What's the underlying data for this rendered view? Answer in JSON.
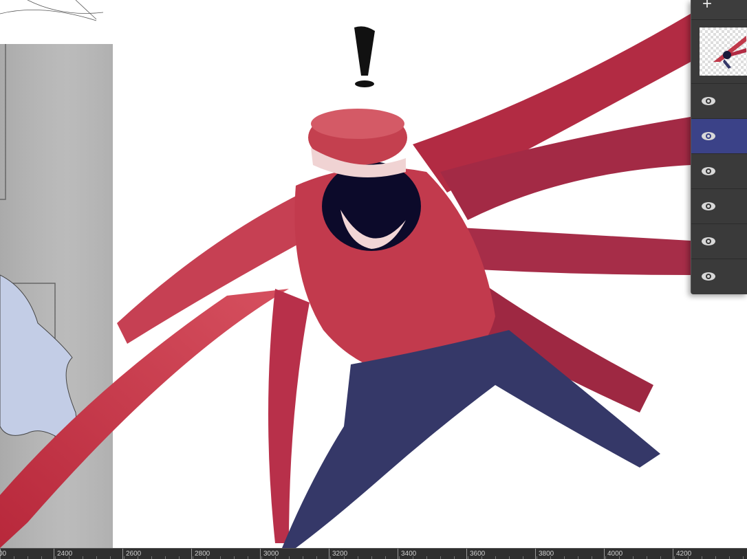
{
  "layers_panel": {
    "add_icon": "plus-icon",
    "layers": [
      {
        "name": "layer-thumbnail",
        "visible_icon": "eye-icon",
        "selected": false
      },
      {
        "name": "layer-2",
        "visible_icon": "eye-icon",
        "selected": false
      },
      {
        "name": "layer-3",
        "visible_icon": "eye-icon",
        "selected": true
      },
      {
        "name": "layer-4",
        "visible_icon": "eye-icon",
        "selected": false
      },
      {
        "name": "layer-5",
        "visible_icon": "eye-icon",
        "selected": false
      },
      {
        "name": "layer-6",
        "visible_icon": "eye-icon",
        "selected": false
      },
      {
        "name": "layer-7",
        "visible_icon": "eye-icon",
        "selected": false
      }
    ],
    "selected_color": "#3b4288"
  },
  "ruler": {
    "labels": [
      "00",
      "2400",
      "2600",
      "2800",
      "3000",
      "3200",
      "3400",
      "3600",
      "3800",
      "4000",
      "4200"
    ]
  },
  "colors": {
    "coat_red": "#c0394a",
    "pants_navy": "#3a3d6a",
    "panel_bg": "#3a3a3a"
  }
}
